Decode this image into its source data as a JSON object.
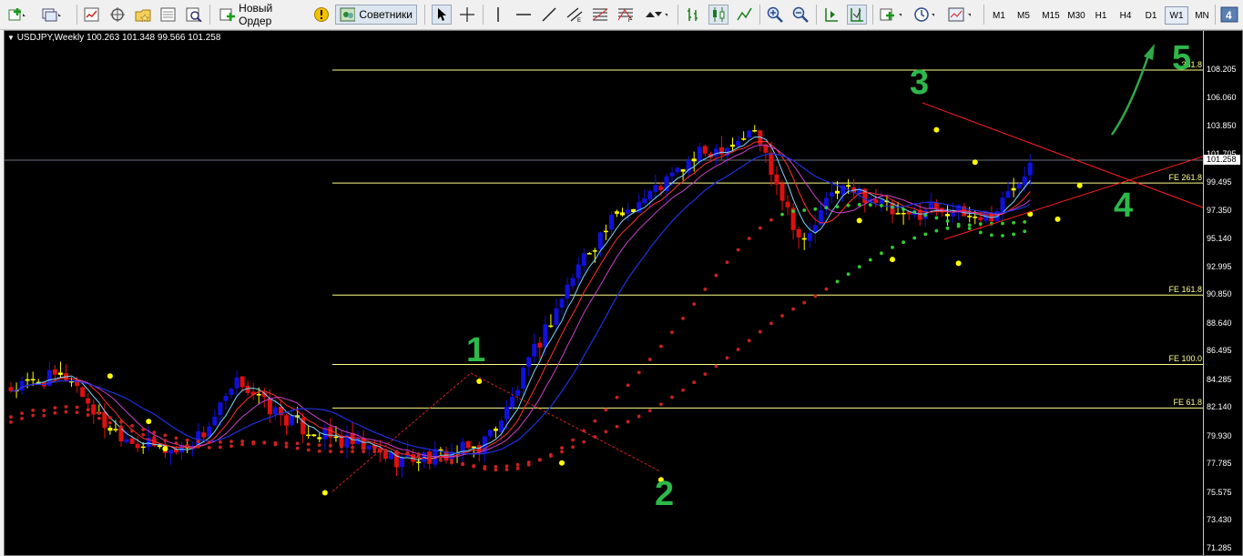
{
  "toolbar": {
    "new_order_label": "Новый Ордер",
    "advisors_label": "Советники",
    "timeframes": [
      "M1",
      "M5",
      "M15",
      "M30",
      "H1",
      "H4",
      "D1",
      "W1",
      "MN"
    ],
    "active_timeframe": "W1"
  },
  "chart": {
    "info": "USDJPY,Weekly  100.263 101.348 99.566 101.258",
    "current_price": "101.258",
    "price_axis": [
      "108.205",
      "106.060",
      "103.850",
      "101.705",
      "99.495",
      "97.350",
      "95.140",
      "92.995",
      "90.850",
      "88.640",
      "86.495",
      "84.285",
      "82.140",
      "79.930",
      "77.785",
      "75.575",
      "73.430",
      "71.285"
    ],
    "fib_levels": [
      {
        "label": "361.8",
        "value": "108.205"
      },
      {
        "label": "FE 261.8",
        "value": "99.495"
      },
      {
        "label": "FE 161.8",
        "value": "90.850"
      },
      {
        "label": "FE 100.0",
        "value": "85.500"
      },
      {
        "label": "FE 61.8",
        "value": "82.140"
      }
    ],
    "wave_labels": [
      "1",
      "2",
      "3",
      "4",
      "5"
    ],
    "colors": {
      "background": "#000000",
      "bull_candle": "#1010dd",
      "bear_candle": "#dd1010",
      "doji_candle": "#ffff00",
      "fib_line": "#ffff88",
      "wave_label": "#2db84a",
      "trend_line": "#ff2020",
      "dotted_ma": "#33cc33"
    }
  }
}
